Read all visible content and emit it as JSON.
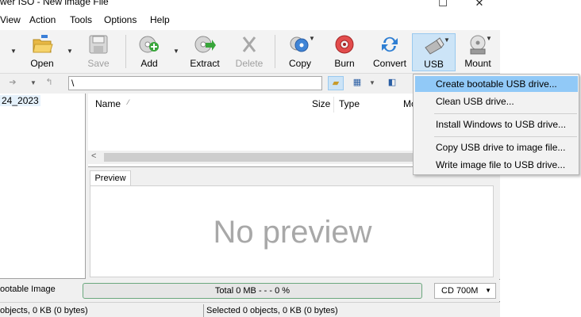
{
  "window": {
    "title": "wer ISO - New image File",
    "minimize": "—",
    "maximize": "☐",
    "close": "✕"
  },
  "menu": [
    "View",
    "Action",
    "Tools",
    "Options",
    "Help"
  ],
  "toolbar": {
    "open": "Open",
    "save": "Save",
    "add": "Add",
    "extract": "Extract",
    "delete": "Delete",
    "copy": "Copy",
    "burn": "Burn",
    "convert": "Convert",
    "usb": "USB",
    "mount": "Mount"
  },
  "address": {
    "path": "\\"
  },
  "tree": {
    "root": "24_2023"
  },
  "list": {
    "columns": [
      "Name",
      "Size",
      "Type",
      "Mo"
    ]
  },
  "preview": {
    "tab": "Preview",
    "empty_text": "No preview"
  },
  "status": {
    "image_type": "ootable Image",
    "total": "Total  0 MB   - - -  0 %",
    "capacity": "CD 700M",
    "left": "objects, 0 KB (0 bytes)",
    "right": "Selected 0 objects, 0 KB (0 bytes)"
  },
  "usb_menu": {
    "items": [
      "Create bootable USB drive...",
      "Clean USB drive...",
      "Install Windows to USB drive...",
      "Copy USB drive to image file...",
      "Write image file to USB drive..."
    ]
  },
  "colors": {
    "highlight": "#91c9f7",
    "active_button": "#cce4f7",
    "progress_border": "#6aa87d"
  }
}
